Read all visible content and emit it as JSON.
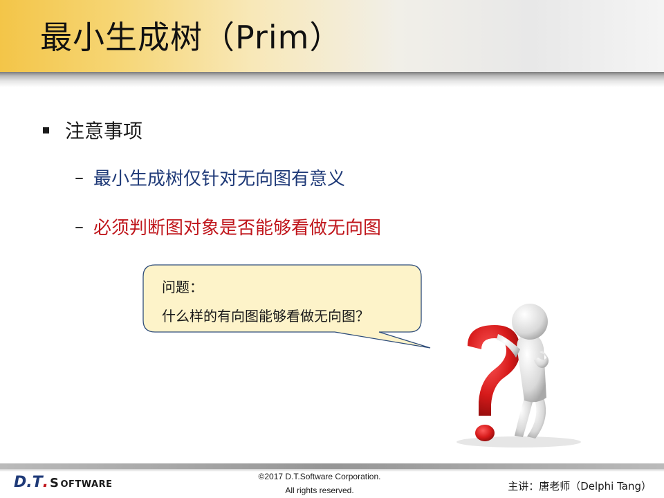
{
  "slide": {
    "title": "最小生成树（Prim）",
    "bullet": "注意事项",
    "sub_bullets": [
      {
        "text": "最小生成树仅针对无向图有意义",
        "color": "#1f3a78"
      },
      {
        "text": "必须判断图对象是否能够看做无向图",
        "color": "#c0161c"
      }
    ],
    "dash": "–"
  },
  "callout": {
    "line1": "问题：",
    "line2": "什么样的有向图能够看做无向图？",
    "fill": "#fdf3c9",
    "border": "#2d4c7a"
  },
  "footer": {
    "logo_dt": "D.T",
    "logo_dot": ".",
    "logo_s": "S",
    "logo_rest": "OFTWARE",
    "copyright_line1": "©2017 D.T.Software Corporation.",
    "copyright_line2": "All rights reserved.",
    "presenter": "主讲：唐老师（Delphi Tang）"
  },
  "illustration": {
    "icon": "question-mark-figure-icon"
  }
}
